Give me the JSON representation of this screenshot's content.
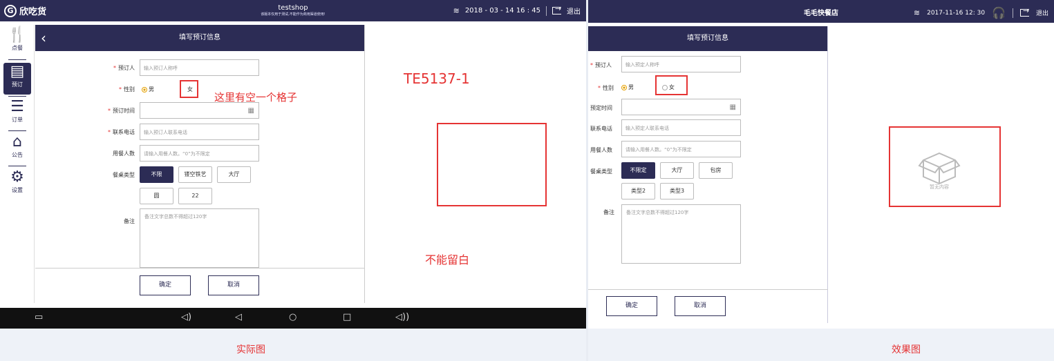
{
  "left": {
    "topbar": {
      "logo": "欣吃货",
      "logo_mark": "G",
      "title": "testshop",
      "subtitle": "该版本仅用于测试,不能作为商用渠道使用!",
      "datetime": "2018 - 03 - 14 16 : 45",
      "exit": "退出"
    },
    "sidebar": [
      {
        "label": "点餐",
        "icon": "fork-knife-icon"
      },
      {
        "label": "预订",
        "icon": "reserve-icon"
      },
      {
        "label": "订单",
        "icon": "orders-icon"
      },
      {
        "label": "公告",
        "icon": "notice-icon"
      },
      {
        "label": "设置",
        "icon": "settings-icon"
      }
    ],
    "form": {
      "title": "填写预订信息",
      "booker_label": "预订人",
      "booker_placeholder": "输入预订人称呼",
      "gender_label": "性别",
      "male": "男",
      "female": "女",
      "time_label": "预订时间",
      "phone_label": "联系电话",
      "phone_placeholder": "输入预订人联系电话",
      "diners_label": "用餐人数",
      "diners_placeholder": "请输入用餐人数。“0”为不限定",
      "table_type_label": "餐桌类型",
      "table_types": [
        "不限",
        "镂空铁艺",
        "大厅",
        "圆",
        "22"
      ],
      "remark_label": "备注",
      "remark_placeholder": "备注文字总数不得超过120字",
      "confirm": "确定",
      "cancel": "取消"
    },
    "annotations": {
      "code": "TE5137-1",
      "space_note": "这里有空一个格子",
      "no_blank": "不能留白"
    },
    "caption": "实际图"
  },
  "right": {
    "topbar": {
      "title": "毛毛快餐店",
      "datetime": "2017-11-16 12: 30",
      "exit": "退出"
    },
    "form": {
      "title": "填写预订信息",
      "booker_label": "预订人",
      "booker_placeholder": "输入预定人称呼",
      "gender_label": "性别",
      "male": "男",
      "female": "女",
      "time_label": "预定时间",
      "phone_label": "联系电话",
      "phone_placeholder": "输入预定人联系电话",
      "diners_label": "用餐人数",
      "diners_placeholder": "请输入用餐人数。“0”为不限定",
      "table_type_label": "餐桌类型",
      "table_types": [
        "不限定",
        "大厅",
        "包房",
        "类型2",
        "类型3"
      ],
      "remark_label": "备注",
      "remark_placeholder": "备注文字总数不得超过120字",
      "confirm": "确定",
      "cancel": "取消"
    },
    "empty_text": "暂无内容",
    "caption": "效果图"
  },
  "colors": {
    "primary": "#2c2c55",
    "annotation": "#e53333",
    "radio_on": "#e4a000"
  }
}
